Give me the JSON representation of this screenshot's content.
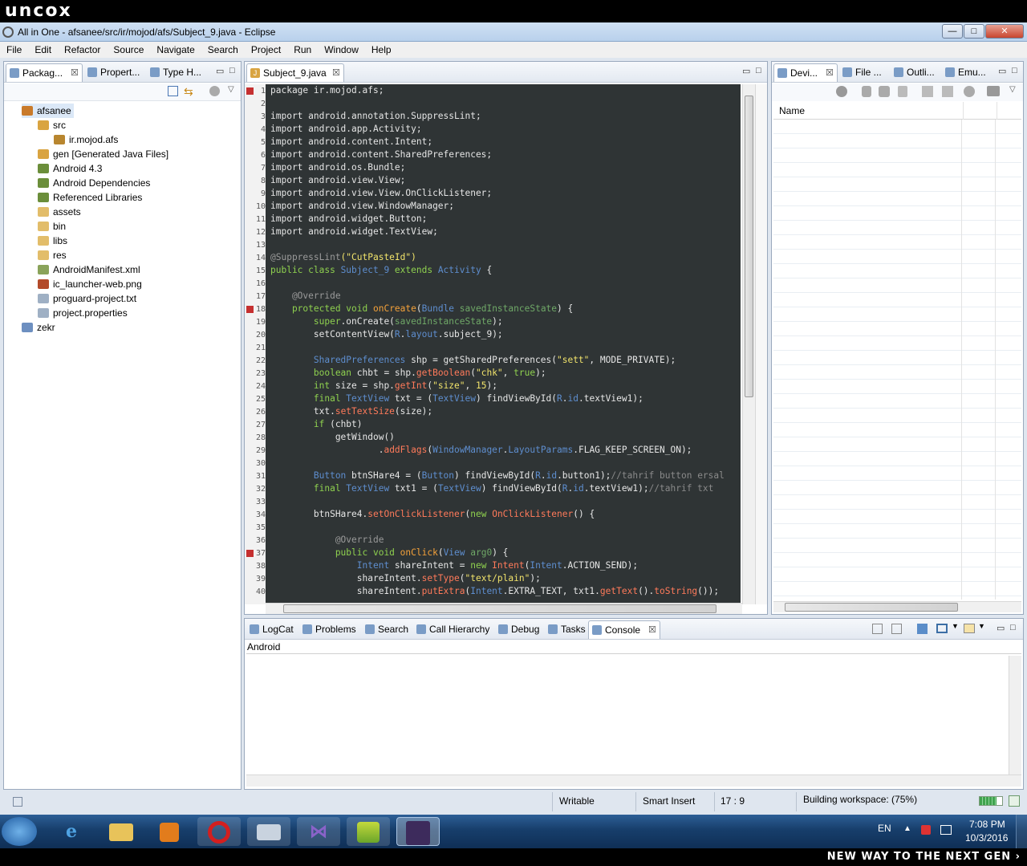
{
  "watermark": {
    "top": "uncox",
    "bottom": "NEW WAY TO THE NEXT GEN ›"
  },
  "window": {
    "title": "All in One - afsanee/src/ir/mojod/afs/Subject_9.java - Eclipse",
    "min": "—",
    "max": "□",
    "close": "✕"
  },
  "menu": [
    "File",
    "Edit",
    "Refactor",
    "Source",
    "Navigate",
    "Search",
    "Project",
    "Run",
    "Window",
    "Help"
  ],
  "left_tabs": [
    {
      "label": "Packag...",
      "icon": "package-explorer-icon"
    },
    {
      "label": "Propert...",
      "icon": "properties-icon"
    },
    {
      "label": "Type H...",
      "icon": "type-hierarchy-icon"
    }
  ],
  "tree": [
    {
      "label": "afsanee",
      "depth": 0,
      "icon": "project-icon",
      "color": "#c97a2a"
    },
    {
      "label": "src",
      "depth": 1,
      "icon": "folder-icon",
      "color": "#d9a441"
    },
    {
      "label": "ir.mojod.afs",
      "depth": 2,
      "icon": "package-icon",
      "color": "#b8862f"
    },
    {
      "label": "gen [Generated Java Files]",
      "depth": 1,
      "icon": "folder-icon",
      "color": "#d9a441"
    },
    {
      "label": "Android 4.3",
      "depth": 1,
      "icon": "library-icon",
      "color": "#6b8e3a"
    },
    {
      "label": "Android Dependencies",
      "depth": 1,
      "icon": "library-icon",
      "color": "#6b8e3a"
    },
    {
      "label": "Referenced Libraries",
      "depth": 1,
      "icon": "library-icon",
      "color": "#6b8e3a"
    },
    {
      "label": "assets",
      "depth": 1,
      "icon": "folder-icon",
      "color": "#e2bd6a"
    },
    {
      "label": "bin",
      "depth": 1,
      "icon": "folder-icon",
      "color": "#e2bd6a"
    },
    {
      "label": "libs",
      "depth": 1,
      "icon": "folder-icon",
      "color": "#e2bd6a"
    },
    {
      "label": "res",
      "depth": 1,
      "icon": "folder-icon",
      "color": "#e2bd6a"
    },
    {
      "label": "AndroidManifest.xml",
      "depth": 1,
      "icon": "xml-file-icon",
      "color": "#8aa35a"
    },
    {
      "label": "ic_launcher-web.png",
      "depth": 1,
      "icon": "image-file-icon",
      "color": "#b34a2a"
    },
    {
      "label": "proguard-project.txt",
      "depth": 1,
      "icon": "text-file-icon",
      "color": "#9fb0c4"
    },
    {
      "label": "project.properties",
      "depth": 1,
      "icon": "text-file-icon",
      "color": "#9fb0c4"
    },
    {
      "label": "zekr",
      "depth": 0,
      "icon": "folder-icon",
      "color": "#6d8fc0"
    }
  ],
  "editor": {
    "tab": "Subject_9.java"
  },
  "code": [
    [
      [
        "package ir.mojod.afs;",
        "#e6e6e6"
      ]
    ],
    [],
    [
      [
        "import android.annotation.SuppressLint;",
        "#e6e6e6"
      ]
    ],
    [
      [
        "import android.app.Activity;",
        "#e6e6e6"
      ]
    ],
    [
      [
        "import android.content.Intent;",
        "#e6e6e6"
      ]
    ],
    [
      [
        "import android.content.SharedPreferences;",
        "#e6e6e6"
      ]
    ],
    [
      [
        "import android.os.Bundle;",
        "#e6e6e6"
      ]
    ],
    [
      [
        "import android.view.View;",
        "#e6e6e6"
      ]
    ],
    [
      [
        "import android.view.View.OnClickListener;",
        "#e6e6e6"
      ]
    ],
    [
      [
        "import android.view.WindowManager;",
        "#e6e6e6"
      ]
    ],
    [
      [
        "import android.widget.Button;",
        "#e6e6e6"
      ]
    ],
    [
      [
        "import android.widget.TextView;",
        "#e6e6e6"
      ]
    ],
    [],
    [
      [
        "@SuppressLint",
        "#9a9a9a"
      ],
      [
        "(\"CutPasteId\")",
        "#f1e36b"
      ]
    ],
    [
      [
        "public class ",
        "#8fd14f"
      ],
      [
        "Subject_9 ",
        "#5e8ecf"
      ],
      [
        "extends ",
        "#8fd14f"
      ],
      [
        "Activity",
        "#5e8ecf"
      ],
      [
        " {",
        "#e6e6e6"
      ]
    ],
    [],
    [
      [
        "    @Override",
        "#9a9a9a"
      ]
    ],
    [
      [
        "    protected void ",
        "#8fd14f"
      ],
      [
        "onCreate",
        "#f5a23a"
      ],
      [
        "(",
        "#e6e6e6"
      ],
      [
        "Bundle ",
        "#5e8ecf"
      ],
      [
        "savedInstanceState",
        "#6fa867"
      ],
      [
        ") {",
        "#e6e6e6"
      ]
    ],
    [
      [
        "        super",
        "#8fd14f"
      ],
      [
        ".onCreate(",
        "#e6e6e6"
      ],
      [
        "savedInstanceState",
        "#6fa867"
      ],
      [
        ");",
        "#e6e6e6"
      ]
    ],
    [
      [
        "        setContentView(",
        "#e6e6e6"
      ],
      [
        "R",
        "#5e8ecf"
      ],
      [
        ".",
        "#e6e6e6"
      ],
      [
        "layout",
        "#5e8ecf"
      ],
      [
        ".subject_9);",
        "#e6e6e6"
      ]
    ],
    [],
    [
      [
        "        SharedPreferences",
        "#5e8ecf"
      ],
      [
        " shp = getSharedPreferences(",
        "#e6e6e6"
      ],
      [
        "\"sett\"",
        "#f1e36b"
      ],
      [
        ", MODE_PRIVATE);",
        "#e6e6e6"
      ]
    ],
    [
      [
        "        boolean ",
        "#8fd14f"
      ],
      [
        "chbt = shp.",
        "#e6e6e6"
      ],
      [
        "getBoolean",
        "#ff7a5a"
      ],
      [
        "(",
        "#e6e6e6"
      ],
      [
        "\"chk\"",
        "#f1e36b"
      ],
      [
        ", ",
        "#e6e6e6"
      ],
      [
        "true",
        "#8fd14f"
      ],
      [
        ");",
        "#e6e6e6"
      ]
    ],
    [
      [
        "        int ",
        "#8fd14f"
      ],
      [
        "size = shp.",
        "#e6e6e6"
      ],
      [
        "getInt",
        "#ff7a5a"
      ],
      [
        "(",
        "#e6e6e6"
      ],
      [
        "\"size\"",
        "#f1e36b"
      ],
      [
        ", ",
        "#e6e6e6"
      ],
      [
        "15",
        "#f1e36b"
      ],
      [
        ");",
        "#e6e6e6"
      ]
    ],
    [
      [
        "        final ",
        "#8fd14f"
      ],
      [
        "TextView ",
        "#5e8ecf"
      ],
      [
        "txt = (",
        "#e6e6e6"
      ],
      [
        "TextView",
        "#5e8ecf"
      ],
      [
        ") findViewById(",
        "#e6e6e6"
      ],
      [
        "R",
        "#5e8ecf"
      ],
      [
        ".",
        "#e6e6e6"
      ],
      [
        "id",
        "#5e8ecf"
      ],
      [
        ".textView1);",
        "#e6e6e6"
      ]
    ],
    [
      [
        "        txt.",
        "#e6e6e6"
      ],
      [
        "setTextSize",
        "#ff7a5a"
      ],
      [
        "(size);",
        "#e6e6e6"
      ]
    ],
    [
      [
        "        if ",
        "#8fd14f"
      ],
      [
        "(chbt)",
        "#e6e6e6"
      ]
    ],
    [
      [
        "            getWindow()",
        "#e6e6e6"
      ]
    ],
    [
      [
        "                    .",
        "#e6e6e6"
      ],
      [
        "addFlags",
        "#ff7a5a"
      ],
      [
        "(",
        "#e6e6e6"
      ],
      [
        "WindowManager",
        "#5e8ecf"
      ],
      [
        ".",
        "#e6e6e6"
      ],
      [
        "LayoutParams",
        "#5e8ecf"
      ],
      [
        ".FLAG_KEEP_SCREEN_ON);",
        "#e6e6e6"
      ]
    ],
    [],
    [
      [
        "        Button ",
        "#5e8ecf"
      ],
      [
        "btnSHare4 = (",
        "#e6e6e6"
      ],
      [
        "Button",
        "#5e8ecf"
      ],
      [
        ") findViewById(",
        "#e6e6e6"
      ],
      [
        "R",
        "#5e8ecf"
      ],
      [
        ".",
        "#e6e6e6"
      ],
      [
        "id",
        "#5e8ecf"
      ],
      [
        ".button1);",
        "#e6e6e6"
      ],
      [
        "//tahrif button ersal",
        "#8a8a8a"
      ]
    ],
    [
      [
        "        final ",
        "#8fd14f"
      ],
      [
        "TextView ",
        "#5e8ecf"
      ],
      [
        "txt1 = (",
        "#e6e6e6"
      ],
      [
        "TextView",
        "#5e8ecf"
      ],
      [
        ") findViewById(",
        "#e6e6e6"
      ],
      [
        "R",
        "#5e8ecf"
      ],
      [
        ".",
        "#e6e6e6"
      ],
      [
        "id",
        "#5e8ecf"
      ],
      [
        ".textView1);",
        "#e6e6e6"
      ],
      [
        "//tahrif txt",
        "#8a8a8a"
      ]
    ],
    [],
    [
      [
        "        btnSHare4.",
        "#e6e6e6"
      ],
      [
        "setOnClickListener",
        "#ff7a5a"
      ],
      [
        "(",
        "#e6e6e6"
      ],
      [
        "new ",
        "#8fd14f"
      ],
      [
        "OnClickListener",
        "#ff7a5a"
      ],
      [
        "() {",
        "#e6e6e6"
      ]
    ],
    [],
    [
      [
        "            @Override",
        "#9a9a9a"
      ]
    ],
    [
      [
        "            public void ",
        "#8fd14f"
      ],
      [
        "onClick",
        "#f5a23a"
      ],
      [
        "(",
        "#e6e6e6"
      ],
      [
        "View ",
        "#5e8ecf"
      ],
      [
        "arg0",
        "#6fa867"
      ],
      [
        ") {",
        "#e6e6e6"
      ]
    ],
    [
      [
        "                Intent ",
        "#5e8ecf"
      ],
      [
        "shareIntent = ",
        "#e6e6e6"
      ],
      [
        "new ",
        "#8fd14f"
      ],
      [
        "Intent",
        "#ff7a5a"
      ],
      [
        "(",
        "#e6e6e6"
      ],
      [
        "Intent",
        "#5e8ecf"
      ],
      [
        ".ACTION_SEND);",
        "#e6e6e6"
      ]
    ],
    [
      [
        "                shareIntent.",
        "#e6e6e6"
      ],
      [
        "setType",
        "#ff7a5a"
      ],
      [
        "(",
        "#e6e6e6"
      ],
      [
        "\"text/plain\"",
        "#f1e36b"
      ],
      [
        ");",
        "#e6e6e6"
      ]
    ],
    [
      [
        "                shareIntent.",
        "#e6e6e6"
      ],
      [
        "putExtra",
        "#ff7a5a"
      ],
      [
        "(",
        "#e6e6e6"
      ],
      [
        "Intent",
        "#5e8ecf"
      ],
      [
        ".EXTRA_TEXT, txt1.",
        "#e6e6e6"
      ],
      [
        "getText",
        "#ff7a5a"
      ],
      [
        "().",
        "#e6e6e6"
      ],
      [
        "toString",
        "#ff7a5a"
      ],
      [
        "());",
        "#e6e6e6"
      ]
    ]
  ],
  "right_tabs": [
    {
      "label": "Devi...",
      "icon": "device-icon"
    },
    {
      "label": "File ...",
      "icon": "android-icon"
    },
    {
      "label": "Outli...",
      "icon": "outline-icon"
    },
    {
      "label": "Emu...",
      "icon": "emulator-icon"
    }
  ],
  "devices": {
    "column": "Name"
  },
  "bottom_tabs": [
    {
      "label": "LogCat",
      "icon": "logcat-icon"
    },
    {
      "label": "Problems",
      "icon": "problems-icon"
    },
    {
      "label": "Search",
      "icon": "search-icon"
    },
    {
      "label": "Call Hierarchy",
      "icon": "call-hierarchy-icon"
    },
    {
      "label": "Debug",
      "icon": "debug-icon"
    },
    {
      "label": "Tasks",
      "icon": "tasks-icon"
    },
    {
      "label": "Console",
      "icon": "console-icon"
    }
  ],
  "console": {
    "header": "Android"
  },
  "status": {
    "writable": "Writable",
    "insert": "Smart Insert",
    "position": "17 : 9",
    "progress_label": "Building workspace: (75%)",
    "progress": 0.75
  },
  "taskbar": {
    "apps": [
      "start-orb",
      "ie-icon",
      "explorer-icon",
      "media-player-icon",
      "opera-icon",
      "keyboard-icon",
      "visual-studio-icon",
      "android-sdk-icon",
      "javaee-ide-icon"
    ],
    "lang": "EN",
    "time": "7:08 PM",
    "date": "10/3/2016"
  }
}
